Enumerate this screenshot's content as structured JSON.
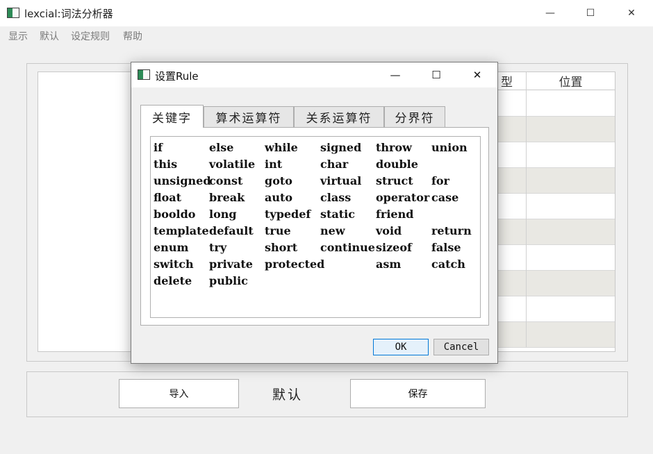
{
  "window": {
    "title": "lexcial:词法分析器",
    "minimize_glyph": "—",
    "maximize_glyph": "☐",
    "close_glyph": "✕"
  },
  "menu": [
    "显示",
    "默认",
    "设定规则",
    "帮助"
  ],
  "table": {
    "headers": [
      "型",
      "位置"
    ]
  },
  "bottom": {
    "import_label": "导入",
    "default_label": "默认",
    "save_label": "保存"
  },
  "dialog": {
    "title": "设置Rule",
    "minimize_glyph": "—",
    "maximize_glyph": "☐",
    "close_glyph": "✕",
    "tabs": [
      "关键字",
      "算术运算符",
      "关系运算符",
      "分界符"
    ],
    "active_tab": "关键字",
    "keyword_rows": [
      [
        "if",
        "else",
        "while",
        "signed",
        "throw",
        "union"
      ],
      [
        "this",
        "volatile",
        "int",
        "char",
        "double",
        ""
      ],
      [
        "unsigned",
        "const",
        "goto",
        "virtual",
        "struct",
        "for"
      ],
      [
        "float",
        "break",
        "auto",
        "class",
        "operator",
        "case"
      ],
      [
        "booldo",
        "long",
        "typedef",
        "static",
        "friend",
        ""
      ],
      [
        "template",
        "default",
        "true",
        "new",
        "void",
        "return"
      ],
      [
        "enum",
        "try",
        "short",
        "continue",
        "sizeof",
        "false"
      ],
      [
        "switch",
        "private",
        "protected",
        "",
        "asm",
        "catch"
      ],
      [
        "delete",
        "public",
        "",
        "",
        "",
        ""
      ]
    ],
    "ok_label": "OK",
    "cancel_label": "Cancel"
  },
  "colors": {
    "accent": "#0078d7",
    "alt_row": "#e9e8e3",
    "background": "#f0f0f0"
  }
}
